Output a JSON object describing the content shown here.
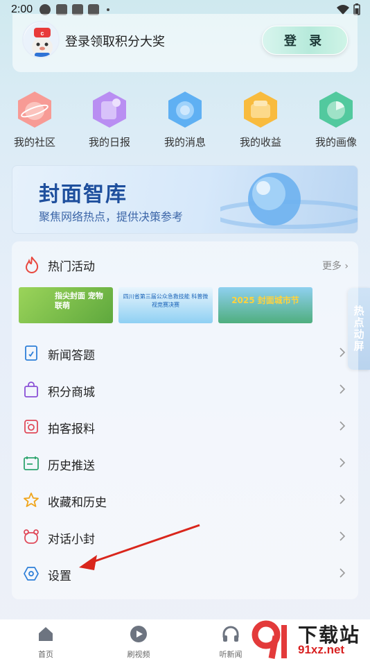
{
  "status_bar": {
    "time": "2:00"
  },
  "header": {
    "login_prompt": "登录领取积分大奖",
    "login_button": "登 录"
  },
  "shortcuts": [
    {
      "label": "我的社区",
      "icon": "community-icon",
      "color": "#f58b86"
    },
    {
      "label": "我的日报",
      "icon": "daily-report-icon",
      "color": "#b48bf0"
    },
    {
      "label": "我的消息",
      "icon": "message-icon",
      "color": "#5aa8f0"
    },
    {
      "label": "我的收益",
      "icon": "earnings-icon",
      "color": "#f7b93c"
    },
    {
      "label": "我的画像",
      "icon": "portrait-icon",
      "color": "#4cc79a"
    }
  ],
  "banner": {
    "title": "封面智库",
    "subtitle": "聚焦网络热点，提供决策参考"
  },
  "hot_activities": {
    "title": "热门活动",
    "more": "更多",
    "thumbnails": [
      {
        "text": "指尖封面 宠物联萌",
        "color": "#7fc24a"
      },
      {
        "text": "四川省第三届公众急救技能 科普微视竞赛决赛",
        "color": "#5aaee6"
      },
      {
        "text": "2025 封面城市节",
        "color": "#47a67d"
      }
    ]
  },
  "menu": [
    {
      "label": "新闻答题",
      "icon": "quiz-icon",
      "color": "#2e7fd8"
    },
    {
      "label": "积分商城",
      "icon": "shopping-bag-icon",
      "color": "#8a4fd6"
    },
    {
      "label": "拍客报料",
      "icon": "camera-icon",
      "color": "#e04a5a"
    },
    {
      "label": "历史推送",
      "icon": "calendar-icon",
      "color": "#2ea46f"
    },
    {
      "label": "收藏和历史",
      "icon": "star-icon",
      "color": "#f0a51c"
    },
    {
      "label": "对话小封",
      "icon": "bear-chat-icon",
      "color": "#e04a5a"
    },
    {
      "label": "设置",
      "icon": "settings-icon",
      "color": "#2e7fd8"
    }
  ],
  "side_tab": {
    "label": "热点动屏"
  },
  "tabbar": [
    {
      "label": "首页",
      "icon": "home-icon"
    },
    {
      "label": "刷视频",
      "icon": "video-icon"
    },
    {
      "label": "听新闻",
      "icon": "headphones-icon"
    }
  ],
  "watermark": {
    "text1": "下载站",
    "text2": "91xz.net"
  }
}
